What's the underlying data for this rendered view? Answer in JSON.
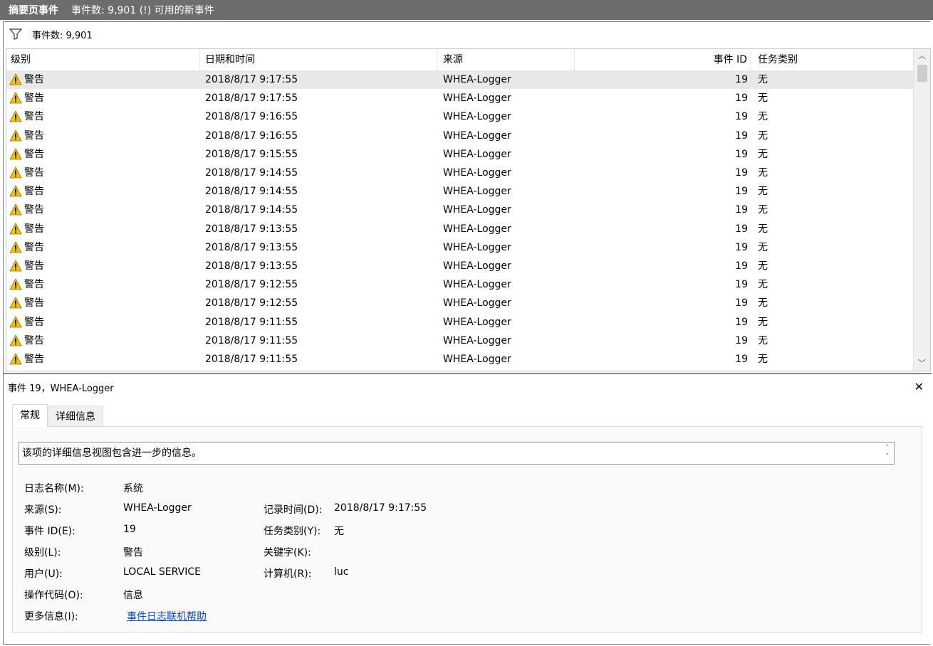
{
  "titlebar": {
    "title": "摘要页事件",
    "summary": "事件数: 9,901 (!) 可用的新事件"
  },
  "filter": {
    "label": "事件数: 9,901"
  },
  "grid": {
    "columns": {
      "level": "级别",
      "datetime": "日期和时间",
      "source": "来源",
      "event_id": "事件 ID",
      "task": "任务类别"
    },
    "rows": [
      {
        "level": "警告",
        "datetime": "2018/8/17 9:17:55",
        "source": "WHEA-Logger",
        "event_id": "19",
        "task": "无"
      },
      {
        "level": "警告",
        "datetime": "2018/8/17 9:17:55",
        "source": "WHEA-Logger",
        "event_id": "19",
        "task": "无"
      },
      {
        "level": "警告",
        "datetime": "2018/8/17 9:16:55",
        "source": "WHEA-Logger",
        "event_id": "19",
        "task": "无"
      },
      {
        "level": "警告",
        "datetime": "2018/8/17 9:16:55",
        "source": "WHEA-Logger",
        "event_id": "19",
        "task": "无"
      },
      {
        "level": "警告",
        "datetime": "2018/8/17 9:15:55",
        "source": "WHEA-Logger",
        "event_id": "19",
        "task": "无"
      },
      {
        "level": "警告",
        "datetime": "2018/8/17 9:14:55",
        "source": "WHEA-Logger",
        "event_id": "19",
        "task": "无"
      },
      {
        "level": "警告",
        "datetime": "2018/8/17 9:14:55",
        "source": "WHEA-Logger",
        "event_id": "19",
        "task": "无"
      },
      {
        "level": "警告",
        "datetime": "2018/8/17 9:14:55",
        "source": "WHEA-Logger",
        "event_id": "19",
        "task": "无"
      },
      {
        "level": "警告",
        "datetime": "2018/8/17 9:13:55",
        "source": "WHEA-Logger",
        "event_id": "19",
        "task": "无"
      },
      {
        "level": "警告",
        "datetime": "2018/8/17 9:13:55",
        "source": "WHEA-Logger",
        "event_id": "19",
        "task": "无"
      },
      {
        "level": "警告",
        "datetime": "2018/8/17 9:13:55",
        "source": "WHEA-Logger",
        "event_id": "19",
        "task": "无"
      },
      {
        "level": "警告",
        "datetime": "2018/8/17 9:12:55",
        "source": "WHEA-Logger",
        "event_id": "19",
        "task": "无"
      },
      {
        "level": "警告",
        "datetime": "2018/8/17 9:12:55",
        "source": "WHEA-Logger",
        "event_id": "19",
        "task": "无"
      },
      {
        "level": "警告",
        "datetime": "2018/8/17 9:11:55",
        "source": "WHEA-Logger",
        "event_id": "19",
        "task": "无"
      },
      {
        "level": "警告",
        "datetime": "2018/8/17 9:11:55",
        "source": "WHEA-Logger",
        "event_id": "19",
        "task": "无"
      },
      {
        "level": "警告",
        "datetime": "2018/8/17 9:11:55",
        "source": "WHEA-Logger",
        "event_id": "19",
        "task": "无"
      }
    ],
    "selected_row": 0,
    "scroll_up_icon": "chevron-up-icon",
    "scroll_down_icon": "chevron-down-icon"
  },
  "detail": {
    "title": "事件 19，WHEA-Logger",
    "close_icon": "close-icon",
    "tabs": {
      "general": "常规",
      "details": "详细信息"
    },
    "active_tab": "general",
    "description": "该项的详细信息视图包含进一步的信息。",
    "labels": {
      "log_name": "日志名称(M):",
      "source": "来源(S):",
      "event_id": "事件 ID(E):",
      "level": "级别(L):",
      "user": "用户(U):",
      "opcode": "操作代码(O):",
      "more_info": "更多信息(I):",
      "logged": "记录时间(D):",
      "task": "任务类别(Y):",
      "keywords": "关键字(K):",
      "computer": "计算机(R):"
    },
    "values": {
      "log_name": "系统",
      "source": "WHEA-Logger",
      "event_id": "19",
      "level": "警告",
      "user": "LOCAL SERVICE",
      "opcode": "信息",
      "more_info_link": "事件日志联机帮助",
      "logged": "2018/8/17 9:17:55",
      "task": "无",
      "keywords": "",
      "computer": "luc"
    }
  },
  "colors": {
    "titlebar_bg": "#6d6d6d",
    "selected_row_bg": "#e8e8e8",
    "link": "#0645d6",
    "warning_fill": "#f5c400"
  },
  "icons": {
    "filter": "filter-funnel-icon",
    "warning": "warning-triangle-icon"
  }
}
